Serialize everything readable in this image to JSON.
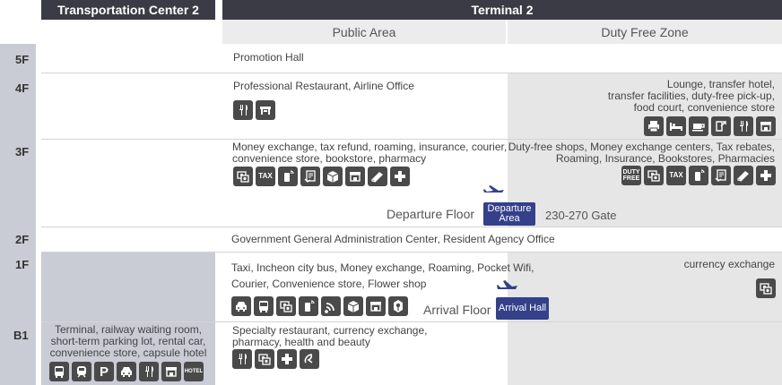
{
  "headers": {
    "tc2": "Transportation Center 2",
    "t2": "Terminal 2",
    "public_area": "Public Area",
    "duty_free_zone": "Duty Free Zone"
  },
  "floors": {
    "f5": "5F",
    "f4": "4F",
    "f3": "3F",
    "f2": "2F",
    "f1": "1F",
    "b1": "B1"
  },
  "cells": {
    "f5_public": "Promotion Hall",
    "f4_public": "Professional Restaurant, Airline Office",
    "f4_dutyfree": [
      "Lounge, transfer hotel,",
      "transfer facilities, duty-free pick-up,",
      "food court, convenience store"
    ],
    "f3_public": [
      "Money exchange, tax refund, roaming, insurance, courier,",
      "convenience store, bookstore, pharmacy"
    ],
    "f3_dutyfree": [
      "Duty-free shops, Money exchange centers, Tax rebates,",
      "Roaming, Insurance, Bookstores, Pharmacies"
    ],
    "departure_floor": "Departure Floor",
    "departure_area": [
      "Departure",
      "Area"
    ],
    "gate_range": "230-270 Gate",
    "f2_public": "Government General Administration Center, Resident Agency Office",
    "f1_public": [
      "Taxi, Incheon city bus, Money exchange, Roaming, Pocket Wifi,",
      "Courier, Convenience store, Flower shop"
    ],
    "f1_dutyfree": "currency exchange",
    "arrival_floor": "Arrival Floor",
    "arrival_hall": "Arrival Hall",
    "b1_public": [
      "Specialty restaurant, currency exchange,",
      "pharmacy, health and beauty"
    ],
    "b1_tc2": [
      "Terminal, railway waiting room,",
      "short-term parking lot, rental car,",
      "convenience store, capsule hotel"
    ]
  },
  "icon_text": {
    "tax": "TAX",
    "duty_free": [
      "DUTY",
      "FREE"
    ],
    "hotel": "HOTEL",
    "parking": "P"
  },
  "icons": {
    "f4_public": [
      "restaurant-icon",
      "airline-office-icon"
    ],
    "f4_dutyfree": [
      "print-icon",
      "bed-icon",
      "cafe-icon",
      "transfer-icon",
      "restaurant-icon",
      "store-icon"
    ],
    "f3_public": [
      "money-exchange-icon",
      "tax-refund-icon",
      "roaming-icon",
      "insurance-icon",
      "courier-icon",
      "convenience-store-icon",
      "bookstore-icon",
      "pharmacy-icon"
    ],
    "f3_dutyfree": [
      "duty-free-icon",
      "money-exchange-icon",
      "tax-refund-icon",
      "roaming-icon",
      "insurance-icon",
      "bookstore-icon",
      "pharmacy-icon"
    ],
    "f1_public": [
      "taxi-icon",
      "bus-icon",
      "money-exchange-icon",
      "roaming-icon",
      "wifi-icon",
      "courier-icon",
      "convenience-store-icon",
      "flower-shop-icon"
    ],
    "f1_dutyfree": [
      "money-exchange-icon"
    ],
    "b1_public": [
      "restaurant-icon",
      "money-exchange-icon",
      "pharmacy-icon",
      "health-beauty-icon"
    ],
    "b1_tc2": [
      "bus-icon",
      "train-icon",
      "parking-icon",
      "rental-car-icon",
      "restaurant-icon",
      "store-icon",
      "hotel-icon"
    ]
  },
  "colors": {
    "header_bg": "#3b3b45",
    "floor_column_bg": "#c9ccd4",
    "duty_free_bg": "#e6e6e6",
    "accent_badge": "#34408a",
    "icon_bg": "#4a4a4a"
  }
}
